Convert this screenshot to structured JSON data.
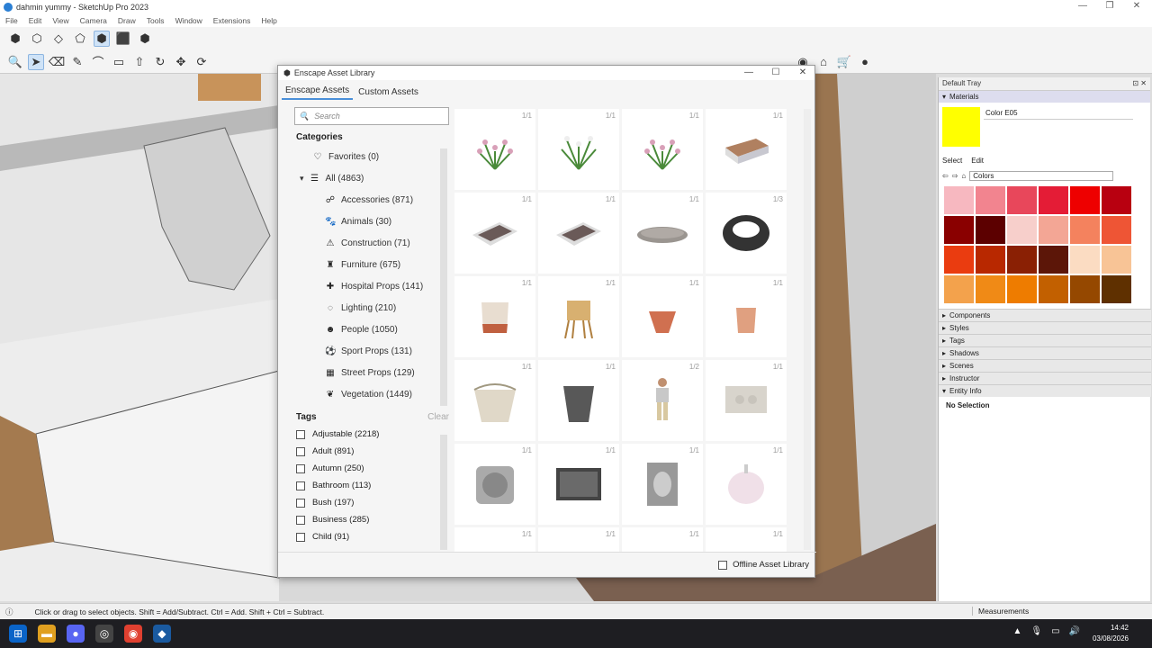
{
  "window": {
    "title": "dahmin yummy - SketchUp Pro 2023"
  },
  "menu": [
    "File",
    "Edit",
    "View",
    "Camera",
    "Draw",
    "Tools",
    "Window",
    "Extensions",
    "Help"
  ],
  "dialog": {
    "title": "Enscape Asset Library",
    "tabs": [
      {
        "label": "Enscape Assets",
        "active": true
      },
      {
        "label": "Custom Assets",
        "active": false
      }
    ],
    "search_placeholder": "Search",
    "categories_title": "Categories",
    "categories": [
      {
        "label": "Favorites (0)",
        "icon": "heart-icon"
      },
      {
        "label": "All (4863)",
        "icon": "list-icon"
      },
      {
        "label": "Accessories (871)",
        "icon": "accessories-icon"
      },
      {
        "label": "Animals (30)",
        "icon": "paw-icon"
      },
      {
        "label": "Construction (71)",
        "icon": "construction-icon"
      },
      {
        "label": "Furniture (675)",
        "icon": "furniture-icon"
      },
      {
        "label": "Hospital Props (141)",
        "icon": "hospital-icon"
      },
      {
        "label": "Lighting (210)",
        "icon": "bulb-icon"
      },
      {
        "label": "People (1050)",
        "icon": "people-icon"
      },
      {
        "label": "Sport Props (131)",
        "icon": "sport-icon"
      },
      {
        "label": "Street Props (129)",
        "icon": "street-icon"
      },
      {
        "label": "Vegetation (1449)",
        "icon": "leaf-icon"
      }
    ],
    "tags_title": "Tags",
    "tags_clear": "Clear",
    "tags": [
      "Adjustable (2218)",
      "Adult (891)",
      "Autumn (250)",
      "Bathroom (113)",
      "Bush (197)",
      "Business (285)",
      "Child (91)"
    ],
    "assets": [
      {
        "count": "1/1",
        "kind": "plant-pink"
      },
      {
        "count": "1/1",
        "kind": "plant-white"
      },
      {
        "count": "1/1",
        "kind": "plant-pink"
      },
      {
        "count": "1/1",
        "kind": "box-tray"
      },
      {
        "count": "1/1",
        "kind": "flat-tray"
      },
      {
        "count": "1/1",
        "kind": "flat-tray"
      },
      {
        "count": "1/1",
        "kind": "round-plate"
      },
      {
        "count": "1/3",
        "kind": "ring"
      },
      {
        "count": "1/1",
        "kind": "pot-beige"
      },
      {
        "count": "1/1",
        "kind": "stool"
      },
      {
        "count": "1/1",
        "kind": "pot-terracotta"
      },
      {
        "count": "1/1",
        "kind": "pot-small"
      },
      {
        "count": "1/1",
        "kind": "basket"
      },
      {
        "count": "1/1",
        "kind": "pot-grey"
      },
      {
        "count": "1/2",
        "kind": "person"
      },
      {
        "count": "1/1",
        "kind": "wall-plate"
      },
      {
        "count": "1/1",
        "kind": "wall-switch"
      },
      {
        "count": "1/1",
        "kind": "frame"
      },
      {
        "count": "1/1",
        "kind": "flush-plate"
      },
      {
        "count": "1/1",
        "kind": "garlic"
      },
      {
        "count": "1/1",
        "kind": "empty"
      },
      {
        "count": "1/1",
        "kind": "empty"
      },
      {
        "count": "1/1",
        "kind": "empty"
      },
      {
        "count": "1/1",
        "kind": "empty"
      }
    ],
    "offline_label": "Offline Asset Library"
  },
  "tray": {
    "title": "Default Tray",
    "materials_label": "Materials",
    "color_name": "Color E05",
    "color_value": "#ffff00",
    "select_label": "Select",
    "edit_label": "Edit",
    "collection": "Colors",
    "swatches": [
      "#f7b8c0",
      "#f2848f",
      "#e8475b",
      "#e41c36",
      "#ee0000",
      "#b80010",
      "#8a0000",
      "#5c0000",
      "#f7cfcb",
      "#f3a695",
      "#f4825e",
      "#ee5535",
      "#ea3c10",
      "#b82800",
      "#8a2004",
      "#5c1608",
      "#fbdcc2",
      "#f8c496",
      "#f3a24c",
      "#f08a16",
      "#ee7c00",
      "#c26000",
      "#954800",
      "#5f3000"
    ],
    "sections": [
      "Components",
      "Styles",
      "Tags",
      "Shadows",
      "Scenes",
      "Instructor",
      "Entity Info"
    ],
    "entity_info": "No Selection"
  },
  "status": {
    "message": "Click or drag to select objects. Shift = Add/Subtract. Ctrl = Add. Shift + Ctrl = Subtract.",
    "measurements": "Measurements"
  },
  "clock": {
    "time": "14:42",
    "date": "03/08/2026"
  }
}
